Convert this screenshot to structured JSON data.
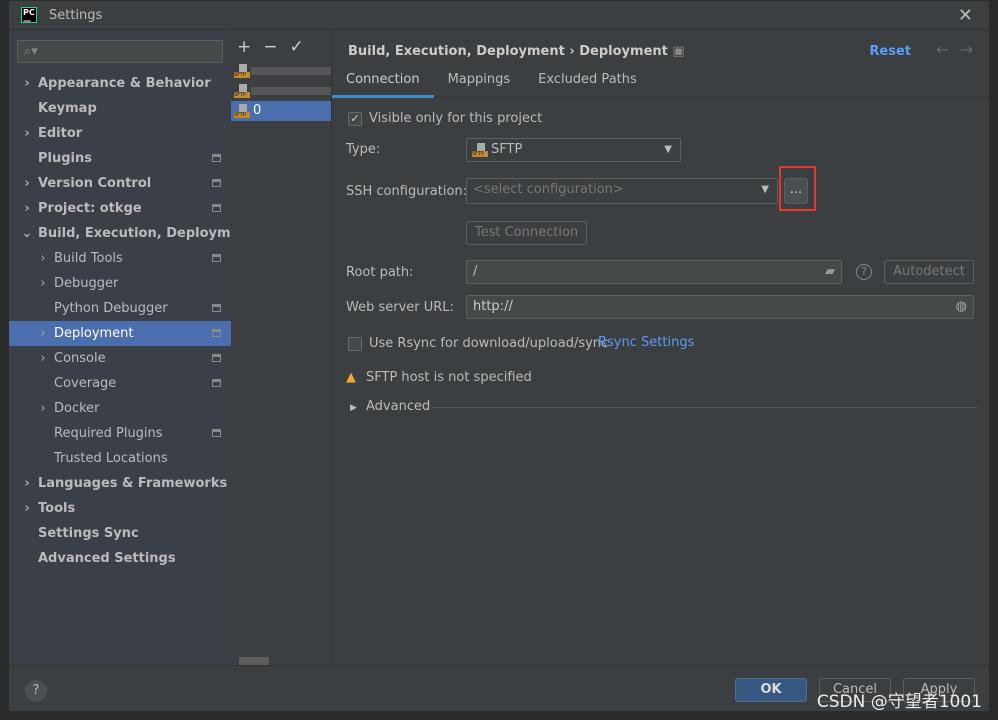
{
  "window": {
    "title": "Settings",
    "logo": "PC"
  },
  "search": {
    "placeholder": ""
  },
  "sidebar": {
    "items": [
      {
        "label": "Appearance & Behavior",
        "level": 0,
        "arrow": true,
        "bold": true
      },
      {
        "label": "Keymap",
        "level": 0,
        "arrow": false,
        "bold": true
      },
      {
        "label": "Editor",
        "level": 0,
        "arrow": true,
        "bold": true
      },
      {
        "label": "Plugins",
        "level": 0,
        "arrow": false,
        "bold": true,
        "pm": true
      },
      {
        "label": "Version Control",
        "level": 0,
        "arrow": true,
        "bold": true,
        "pm": true
      },
      {
        "label": "Project: otkge",
        "level": 0,
        "arrow": true,
        "bold": true,
        "pm": true
      },
      {
        "label": "Build, Execution, Deployment",
        "level": 0,
        "arrow": "open",
        "bold": true
      },
      {
        "label": "Build Tools",
        "level": 1,
        "arrow": true,
        "pm": true
      },
      {
        "label": "Debugger",
        "level": 1,
        "arrow": true
      },
      {
        "label": "Python Debugger",
        "level": 1,
        "arrow": false,
        "pm": true
      },
      {
        "label": "Deployment",
        "level": 1,
        "arrow": true,
        "pm": true,
        "selected": true
      },
      {
        "label": "Console",
        "level": 1,
        "arrow": true,
        "pm": true
      },
      {
        "label": "Coverage",
        "level": 1,
        "arrow": false,
        "pm": true
      },
      {
        "label": "Docker",
        "level": 1,
        "arrow": true
      },
      {
        "label": "Required Plugins",
        "level": 1,
        "arrow": false,
        "pm": true
      },
      {
        "label": "Trusted Locations",
        "level": 1,
        "arrow": false
      },
      {
        "label": "Languages & Frameworks",
        "level": 0,
        "arrow": true,
        "bold": true
      },
      {
        "label": "Tools",
        "level": 0,
        "arrow": true,
        "bold": true
      },
      {
        "label": "Settings Sync",
        "level": 0,
        "arrow": false,
        "bold": true
      },
      {
        "label": "Advanced Settings",
        "level": 0,
        "arrow": false,
        "bold": true
      }
    ]
  },
  "servers": {
    "toolbar": [
      "+",
      "−",
      "✓"
    ],
    "items": [
      {
        "label": "",
        "blurred": true
      },
      {
        "label": "",
        "blurred": true
      },
      {
        "label": "0",
        "selected": true
      }
    ],
    "icon_text": "SFTP"
  },
  "header": {
    "breadcrumb": "Build, Execution, Deployment",
    "sep": "›",
    "page": "Deployment",
    "reset": "Reset"
  },
  "tabs": [
    "Connection",
    "Mappings",
    "Excluded Paths"
  ],
  "form": {
    "visible_only": "Visible only for this project",
    "visible_checked": true,
    "type_label": "Type:",
    "type_value": "SFTP",
    "ssh_label": "SSH configuration:",
    "ssh_placeholder": "<select configuration>",
    "ssh_more": "...",
    "test_connection": "Test Connection",
    "root_label": "Root path:",
    "root_value": "/",
    "autodetect": "Autodetect",
    "web_label": "Web server URL:",
    "web_value": "http://",
    "rsync_label": "Use Rsync for download/upload/sync",
    "rsync_checked": false,
    "rsync_settings": "Rsync Settings",
    "warning": "SFTP host is not specified",
    "advanced": "Advanced"
  },
  "footer": {
    "help": "?",
    "ok": "OK",
    "cancel": "Cancel",
    "apply": "Apply"
  },
  "watermark": "CSDN @守望者1001",
  "colors": {
    "accent": "#4b6eaf",
    "link": "#589df6",
    "highlight": "#e53935",
    "warning": "#f0a732"
  }
}
